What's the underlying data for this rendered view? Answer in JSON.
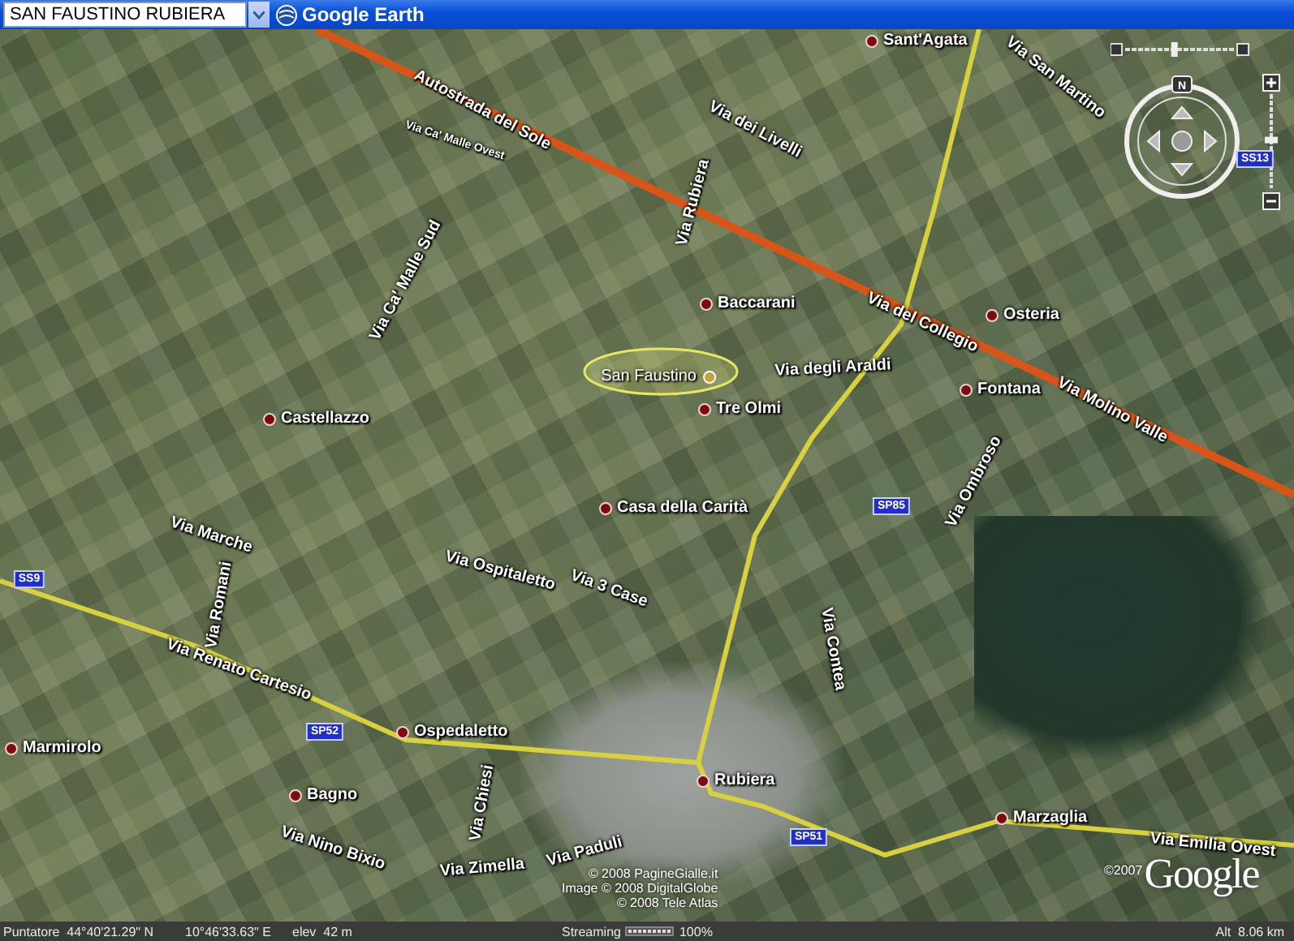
{
  "toolbar": {
    "search": {
      "value": "SAN FAUSTINO RUBIERA"
    },
    "title": "Google Earth"
  },
  "map": {
    "labels": [
      {
        "kind": "road",
        "text": "Autostrada del Sole"
      },
      {
        "kind": "road",
        "text": "Via Ca' Malle Ovest"
      },
      {
        "kind": "road",
        "text": "Via Ca' Malle Sud"
      },
      {
        "kind": "place",
        "text": "Castellazzo"
      },
      {
        "kind": "place",
        "text": "Sant'Agata"
      },
      {
        "kind": "road",
        "text": "Via San Martino"
      },
      {
        "kind": "road",
        "text": "Via dei Livelli"
      },
      {
        "kind": "road",
        "text": "Via Rubiera"
      },
      {
        "kind": "place",
        "text": "Baccarani"
      },
      {
        "kind": "road",
        "text": "Via del Collegio"
      },
      {
        "kind": "place",
        "text": "Osteria"
      },
      {
        "kind": "result",
        "text": "San Faustino"
      },
      {
        "kind": "road",
        "text": "Via degli Araldi"
      },
      {
        "kind": "place",
        "text": "Fontana"
      },
      {
        "kind": "place",
        "text": "Tre Olmi"
      },
      {
        "kind": "road",
        "text": "Via Molino Valle"
      },
      {
        "kind": "road",
        "text": "Via Ombroso"
      },
      {
        "kind": "shield",
        "text": "SP85"
      },
      {
        "kind": "place",
        "text": "Casa della Carità"
      },
      {
        "kind": "road",
        "text": "Via Marche"
      },
      {
        "kind": "shield",
        "text": "SS9"
      },
      {
        "kind": "road",
        "text": "Via Ospitaletto"
      },
      {
        "kind": "road",
        "text": "Via 3 Case"
      },
      {
        "kind": "road",
        "text": "Via Romani"
      },
      {
        "kind": "road",
        "text": "Via Renato Cartesio"
      },
      {
        "kind": "road",
        "text": "Via Contea"
      },
      {
        "kind": "shield",
        "text": "SP52"
      },
      {
        "kind": "place",
        "text": "Ospedaletto"
      },
      {
        "kind": "place",
        "text": "Marmirolo"
      },
      {
        "kind": "place",
        "text": "Bagno"
      },
      {
        "kind": "road",
        "text": "Via Chiesi"
      },
      {
        "kind": "road",
        "text": "Via Nino Bixio"
      },
      {
        "kind": "road",
        "text": "Via Zimella"
      },
      {
        "kind": "road",
        "text": "Via Paduli"
      },
      {
        "kind": "place",
        "text": "Rubiera"
      },
      {
        "kind": "shield",
        "text": "SP51"
      },
      {
        "kind": "place",
        "text": "Marzaglia"
      },
      {
        "kind": "road",
        "text": "Via Emilia Ovest"
      },
      {
        "kind": "shield",
        "text": "SS13"
      }
    ],
    "attribution": [
      "© 2008 PagineGialle.it",
      "Image © 2008 DigitalGlobe",
      "© 2008 Tele Atlas"
    ],
    "logo": {
      "copyright": "©2007",
      "name": "Google"
    },
    "navigation": {
      "north": "N",
      "tilt": {
        "level": 0.45
      },
      "zoom": {
        "level": 0.55
      }
    }
  },
  "status_bar": {
    "pointer": "Puntatore  44°40'21.29\" N",
    "longitude": "10°46'33.63\" E",
    "elevation": "elev  42 m",
    "streaming": "Streaming",
    "stream_progress": {
      "level": 1,
      "reading": "100%"
    },
    "altitude": "Alt  8.06 km"
  }
}
